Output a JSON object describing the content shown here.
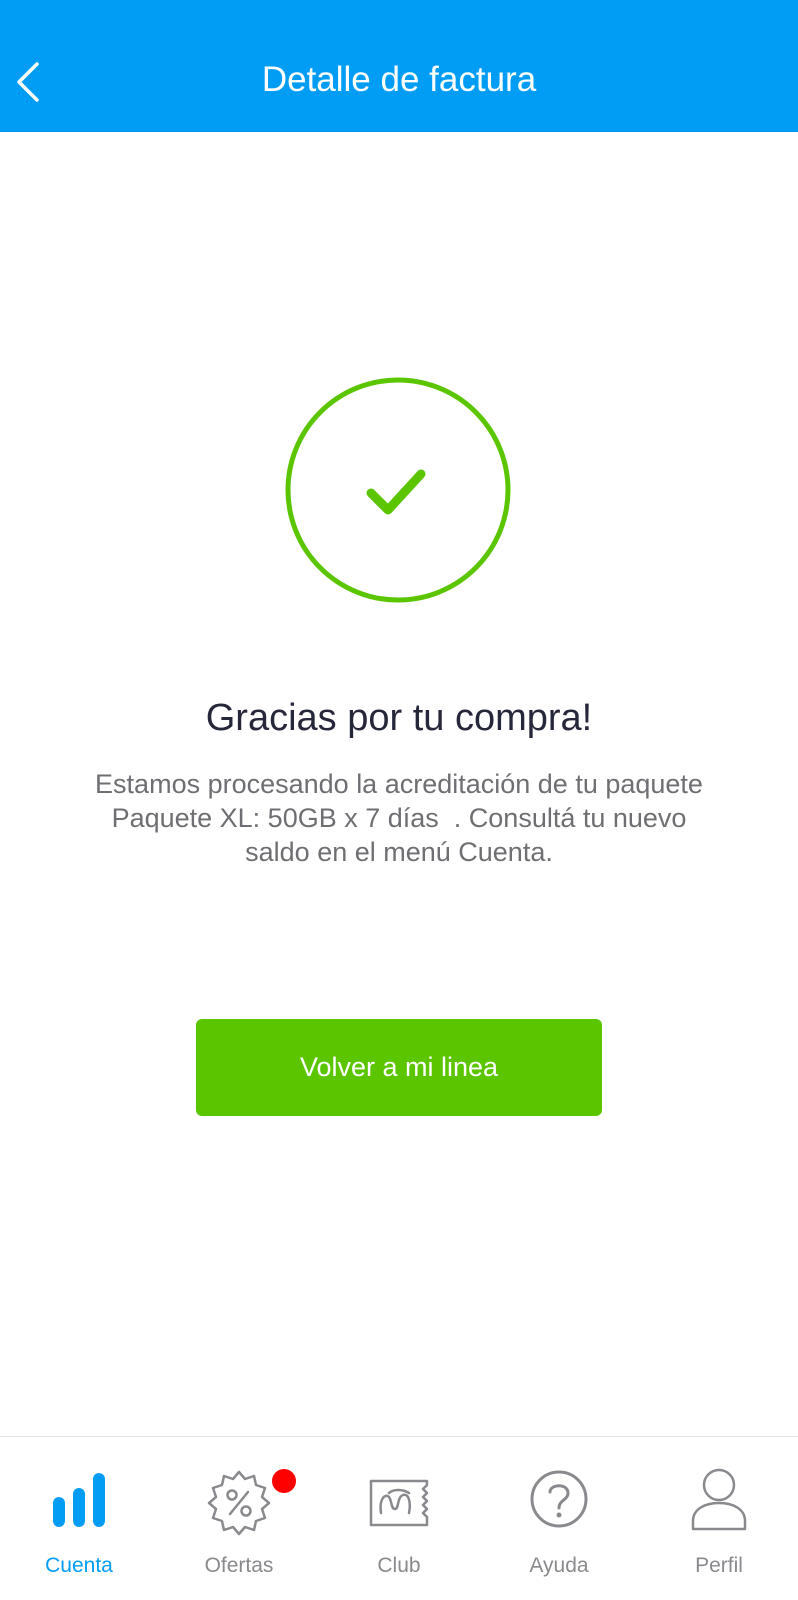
{
  "header": {
    "title": "Detalle de factura"
  },
  "success": {
    "title": "Gracias por tu compra!",
    "message_lines": [
      "Estamos procesando la acreditación de tu paquete",
      "Paquete XL: 50GB x 7 días  . Consultá tu nuevo",
      "saldo en el menú Cuenta."
    ],
    "button_label": "Volver a mi linea"
  },
  "nav": {
    "items": [
      {
        "label": "Cuenta",
        "icon": "bar-chart-icon",
        "active": true
      },
      {
        "label": "Ofertas",
        "icon": "discount-badge-icon",
        "active": false
      },
      {
        "label": "Club",
        "icon": "ticket-icon",
        "active": false
      },
      {
        "label": "Ayuda",
        "icon": "help-circle-icon",
        "active": false
      },
      {
        "label": "Perfil",
        "icon": "user-icon",
        "active": false
      }
    ]
  },
  "colors": {
    "header_bg": "#019df4",
    "success_green": "#5bc500",
    "active_tab": "#019df4",
    "inactive_tab": "#8a8a8e",
    "badge": "#ff0000"
  }
}
